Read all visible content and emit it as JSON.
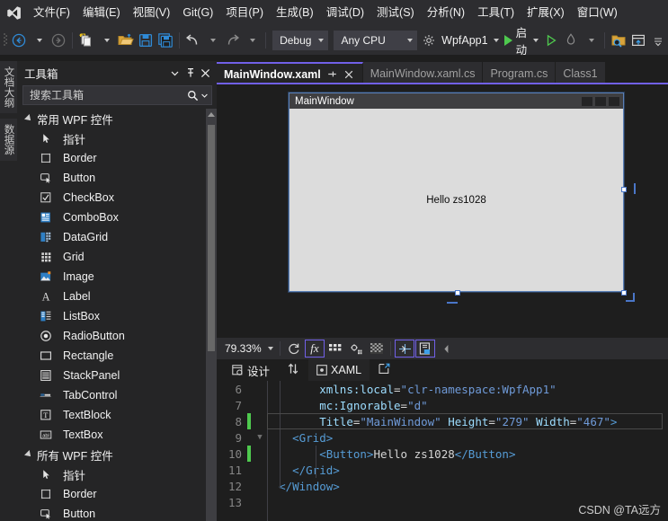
{
  "menubar": {
    "logo_icon": "visual-studio-logo",
    "items": [
      {
        "label": "文件(F)"
      },
      {
        "label": "编辑(E)"
      },
      {
        "label": "视图(V)"
      },
      {
        "label": "Git(G)"
      },
      {
        "label": "项目(P)"
      },
      {
        "label": "生成(B)"
      },
      {
        "label": "调试(D)"
      },
      {
        "label": "测试(S)"
      },
      {
        "label": "分析(N)"
      },
      {
        "label": "工具(T)"
      },
      {
        "label": "扩展(X)"
      },
      {
        "label": "窗口(W)"
      }
    ]
  },
  "toolbar": {
    "navigate_back_icon": "arrow-back-circle-icon",
    "navigate_forward_icon": "arrow-forward-circle-icon",
    "new_item_icon": "new-item-icon",
    "open_file_icon": "open-folder-icon",
    "save_icon": "save-icon",
    "save_all_icon": "save-all-icon",
    "undo_icon": "undo-arrow-icon",
    "redo_icon": "redo-arrow-icon",
    "configuration": "Debug",
    "platform": "Any CPU",
    "startup_project": "WpfApp1",
    "startup_project_icon": "gear-icon",
    "start_label": "启动",
    "start_icon": "play-icon",
    "start_without_debug_icon": "play-outline-icon",
    "hot_reload_icon": "hot-reload-icon",
    "solution_explorer_search_icon": "folder-search-icon",
    "layout_icon": "window-layout-icon"
  },
  "vertical_tabs": [
    {
      "label": "文档大纲"
    },
    {
      "label": "数据源"
    }
  ],
  "toolbox": {
    "title": "工具箱",
    "dropdown_icon": "chevron-down-icon",
    "pin_icon": "pin-icon",
    "close_icon": "close-icon",
    "search_placeholder": "搜索工具箱",
    "search_value": "",
    "search_icon": "search-icon",
    "search_dropdown_icon": "chevron-down-icon",
    "groups": [
      {
        "label": "常用 WPF 控件",
        "expanded": true,
        "items": [
          {
            "label": "指针",
            "icon": "pointer-icon"
          },
          {
            "label": "Border",
            "icon": "border-icon"
          },
          {
            "label": "Button",
            "icon": "button-icon"
          },
          {
            "label": "CheckBox",
            "icon": "checkbox-icon"
          },
          {
            "label": "ComboBox",
            "icon": "combobox-icon"
          },
          {
            "label": "DataGrid",
            "icon": "datagrid-icon"
          },
          {
            "label": "Grid",
            "icon": "grid-icon"
          },
          {
            "label": "Image",
            "icon": "image-icon"
          },
          {
            "label": "Label",
            "icon": "label-icon"
          },
          {
            "label": "ListBox",
            "icon": "listbox-icon"
          },
          {
            "label": "RadioButton",
            "icon": "radiobutton-icon"
          },
          {
            "label": "Rectangle",
            "icon": "rectangle-icon"
          },
          {
            "label": "StackPanel",
            "icon": "stackpanel-icon"
          },
          {
            "label": "TabControl",
            "icon": "tabcontrol-icon"
          },
          {
            "label": "TextBlock",
            "icon": "textblock-icon"
          },
          {
            "label": "TextBox",
            "icon": "textbox-icon"
          }
        ]
      },
      {
        "label": "所有 WPF 控件",
        "expanded": true,
        "items": [
          {
            "label": "指针",
            "icon": "pointer-icon"
          },
          {
            "label": "Border",
            "icon": "border-icon"
          },
          {
            "label": "Button",
            "icon": "button-icon"
          }
        ]
      }
    ]
  },
  "editor": {
    "tabs": [
      {
        "label": "MainWindow.xaml",
        "active": true,
        "pin_icon": "pin-icon",
        "close_icon": "close-icon"
      },
      {
        "label": "MainWindow.xaml.cs",
        "active": false
      },
      {
        "label": "Program.cs",
        "active": false
      },
      {
        "label": "Class1",
        "active": false
      }
    ],
    "accent_color": "#7160e8"
  },
  "designer": {
    "preview": {
      "window_title": "MainWindow",
      "button_text": "Hello zs1028",
      "minimize_icon": "minimize-icon",
      "maximize_icon": "maximize-icon",
      "close_icon": "close-icon"
    },
    "toolbar": {
      "zoom_level": "79.33%",
      "zoom_dropdown_icon": "chevron-down-icon",
      "refresh_icon": "refresh-icon",
      "effects_icon": "fx-icon",
      "grid_icon": "grid-rails-icon",
      "snap_icon": "snap-to-grid-icon",
      "opacity_icon": "checkerboard-icon",
      "align_icon": "align-handles-icon",
      "artboard_icon": "artboard-icon",
      "collapse_icon": "chevron-left-icon"
    }
  },
  "split_bar": {
    "design_label": "设计",
    "design_icon": "design-view-icon",
    "swap_icon": "swap-panes-icon",
    "xaml_label": "XAML",
    "xaml_icon": "xaml-view-icon",
    "popout_icon": "pop-out-icon"
  },
  "code": {
    "first_line_number": 6,
    "lines": [
      {
        "number": 6,
        "changed": false,
        "fold": "",
        "indent": 8,
        "current": false,
        "tokens": [
          {
            "t": "attr",
            "v": "xmlns:local"
          },
          {
            "t": "punct",
            "v": "="
          },
          {
            "t": "str",
            "v": "\"clr-namespace:WpfApp1\""
          }
        ]
      },
      {
        "number": 7,
        "changed": false,
        "fold": "",
        "indent": 8,
        "current": false,
        "tokens": [
          {
            "t": "attr",
            "v": "mc:Ignorable"
          },
          {
            "t": "punct",
            "v": "="
          },
          {
            "t": "str",
            "v": "\"d\""
          }
        ]
      },
      {
        "number": 8,
        "changed": true,
        "fold": "",
        "indent": 8,
        "current": true,
        "tokens": [
          {
            "t": "attr",
            "v": "Title"
          },
          {
            "t": "punct",
            "v": "="
          },
          {
            "t": "str",
            "v": "\"MainWindow\""
          },
          {
            "t": "txt",
            "v": " "
          },
          {
            "t": "attr",
            "v": "Height"
          },
          {
            "t": "punct",
            "v": "="
          },
          {
            "t": "str",
            "v": "\"279\""
          },
          {
            "t": "txt",
            "v": " "
          },
          {
            "t": "attr",
            "v": "Width"
          },
          {
            "t": "punct",
            "v": "="
          },
          {
            "t": "str",
            "v": "\"467\""
          },
          {
            "t": "tag",
            "v": ">"
          }
        ]
      },
      {
        "number": 9,
        "changed": false,
        "fold": "v",
        "indent": 4,
        "current": false,
        "tokens": [
          {
            "t": "tag",
            "v": "<Grid>"
          }
        ]
      },
      {
        "number": 10,
        "changed": true,
        "fold": "",
        "indent": 8,
        "current": false,
        "tokens": [
          {
            "t": "tag",
            "v": "<Button>"
          },
          {
            "t": "txt",
            "v": "Hello zs1028"
          },
          {
            "t": "tag",
            "v": "</Button>"
          }
        ]
      },
      {
        "number": 11,
        "changed": false,
        "fold": "",
        "indent": 4,
        "current": false,
        "tokens": [
          {
            "t": "tag",
            "v": "</Grid>"
          }
        ]
      },
      {
        "number": 12,
        "changed": false,
        "fold": "",
        "indent": 2,
        "current": false,
        "tokens": [
          {
            "t": "tag",
            "v": "</Window>"
          }
        ]
      },
      {
        "number": 13,
        "changed": false,
        "fold": "",
        "indent": 0,
        "current": false,
        "tokens": []
      }
    ]
  },
  "watermark": "CSDN @TA远方"
}
